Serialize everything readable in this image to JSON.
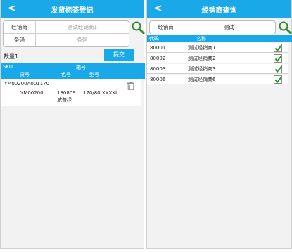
{
  "left_screen": {
    "header": {
      "back": "<",
      "title": "发货标签登记"
    },
    "form": {
      "dealer_label": "经销商",
      "dealer_value": "测试经销商1",
      "barcode_label": "条码",
      "barcode_placeholder": "条码"
    },
    "quantity_label": "数量1",
    "submit_label": "提交",
    "sku_header": {
      "sku": "SKU",
      "box": "箱号",
      "goods": "货号",
      "color": "色号",
      "size": "型号"
    },
    "items": [
      {
        "box": "YM00200A001170",
        "goods": "YM00200",
        "color_code": "130809",
        "color_name": "波普绿",
        "size": "170/80 XXXXL"
      }
    ]
  },
  "right_screen": {
    "header": {
      "back": "<",
      "title": "经销商查询"
    },
    "search": {
      "label": "经销商",
      "value": "测试"
    },
    "columns": {
      "code": "代码",
      "name": "名称"
    },
    "rows": [
      {
        "code": "80001",
        "name": "测试经销商1",
        "checked": true
      },
      {
        "code": "80002",
        "name": "测试经销商2",
        "checked": true
      },
      {
        "code": "80003",
        "name": "测试经销商3",
        "checked": true
      },
      {
        "code": "80006",
        "name": "测试经销商6",
        "checked": true
      }
    ]
  },
  "colors": {
    "accent": "#1aa9e8",
    "check": "#2a9a2a",
    "search_icon": "#2e8b2e"
  }
}
